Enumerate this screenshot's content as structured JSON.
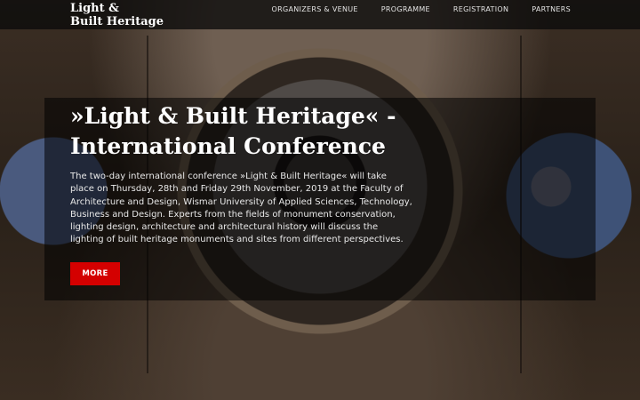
{
  "header": {
    "logo_line1": "Light &",
    "logo_line2": "Built Heritage",
    "nav": [
      {
        "label": "ORGANIZERS & VENUE"
      },
      {
        "label": "PROGRAMME"
      },
      {
        "label": "REGISTRATION"
      },
      {
        "label": "PARTNERS"
      }
    ]
  },
  "hero": {
    "title": "»Light & Built Heritage« - International Conference",
    "description": "The two-day international conference »Light & Built Heritage« will take place on Thursday, 28th and Friday 29th November, 2019 at the Faculty of Architecture and Design, Wismar University of Applied Sciences, Technology, Business and Design. Experts from the fields of monument conservation, lighting design, architecture and architectural history will discuss the lighting of built heritage monuments and sites from different perspectives.",
    "button_label": "MORE"
  },
  "colors": {
    "accent": "#d40000",
    "topbar": "#0a0a0a"
  }
}
